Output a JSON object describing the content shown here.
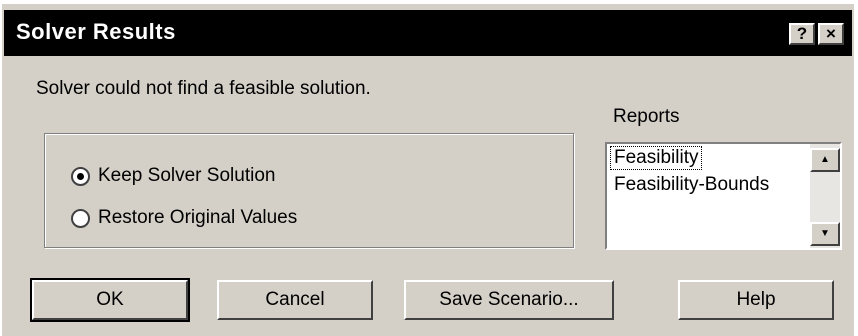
{
  "window": {
    "title": "Solver Results",
    "help_glyph": "?",
    "close_glyph": "×"
  },
  "message": "Solver could not find a feasible solution.",
  "options": {
    "keep": {
      "label": "Keep Solver Solution",
      "selected": true
    },
    "restore": {
      "label": "Restore Original Values",
      "selected": false
    }
  },
  "reports": {
    "label": "Reports",
    "items": [
      "Feasibility",
      "Feasibility-Bounds"
    ],
    "selected_index": 0
  },
  "buttons": {
    "ok": "OK",
    "cancel": "Cancel",
    "save_scenario": "Save Scenario...",
    "help": "Help"
  },
  "icons": {
    "scroll_up": "up-arrow-icon",
    "scroll_down": "down-arrow-icon"
  }
}
